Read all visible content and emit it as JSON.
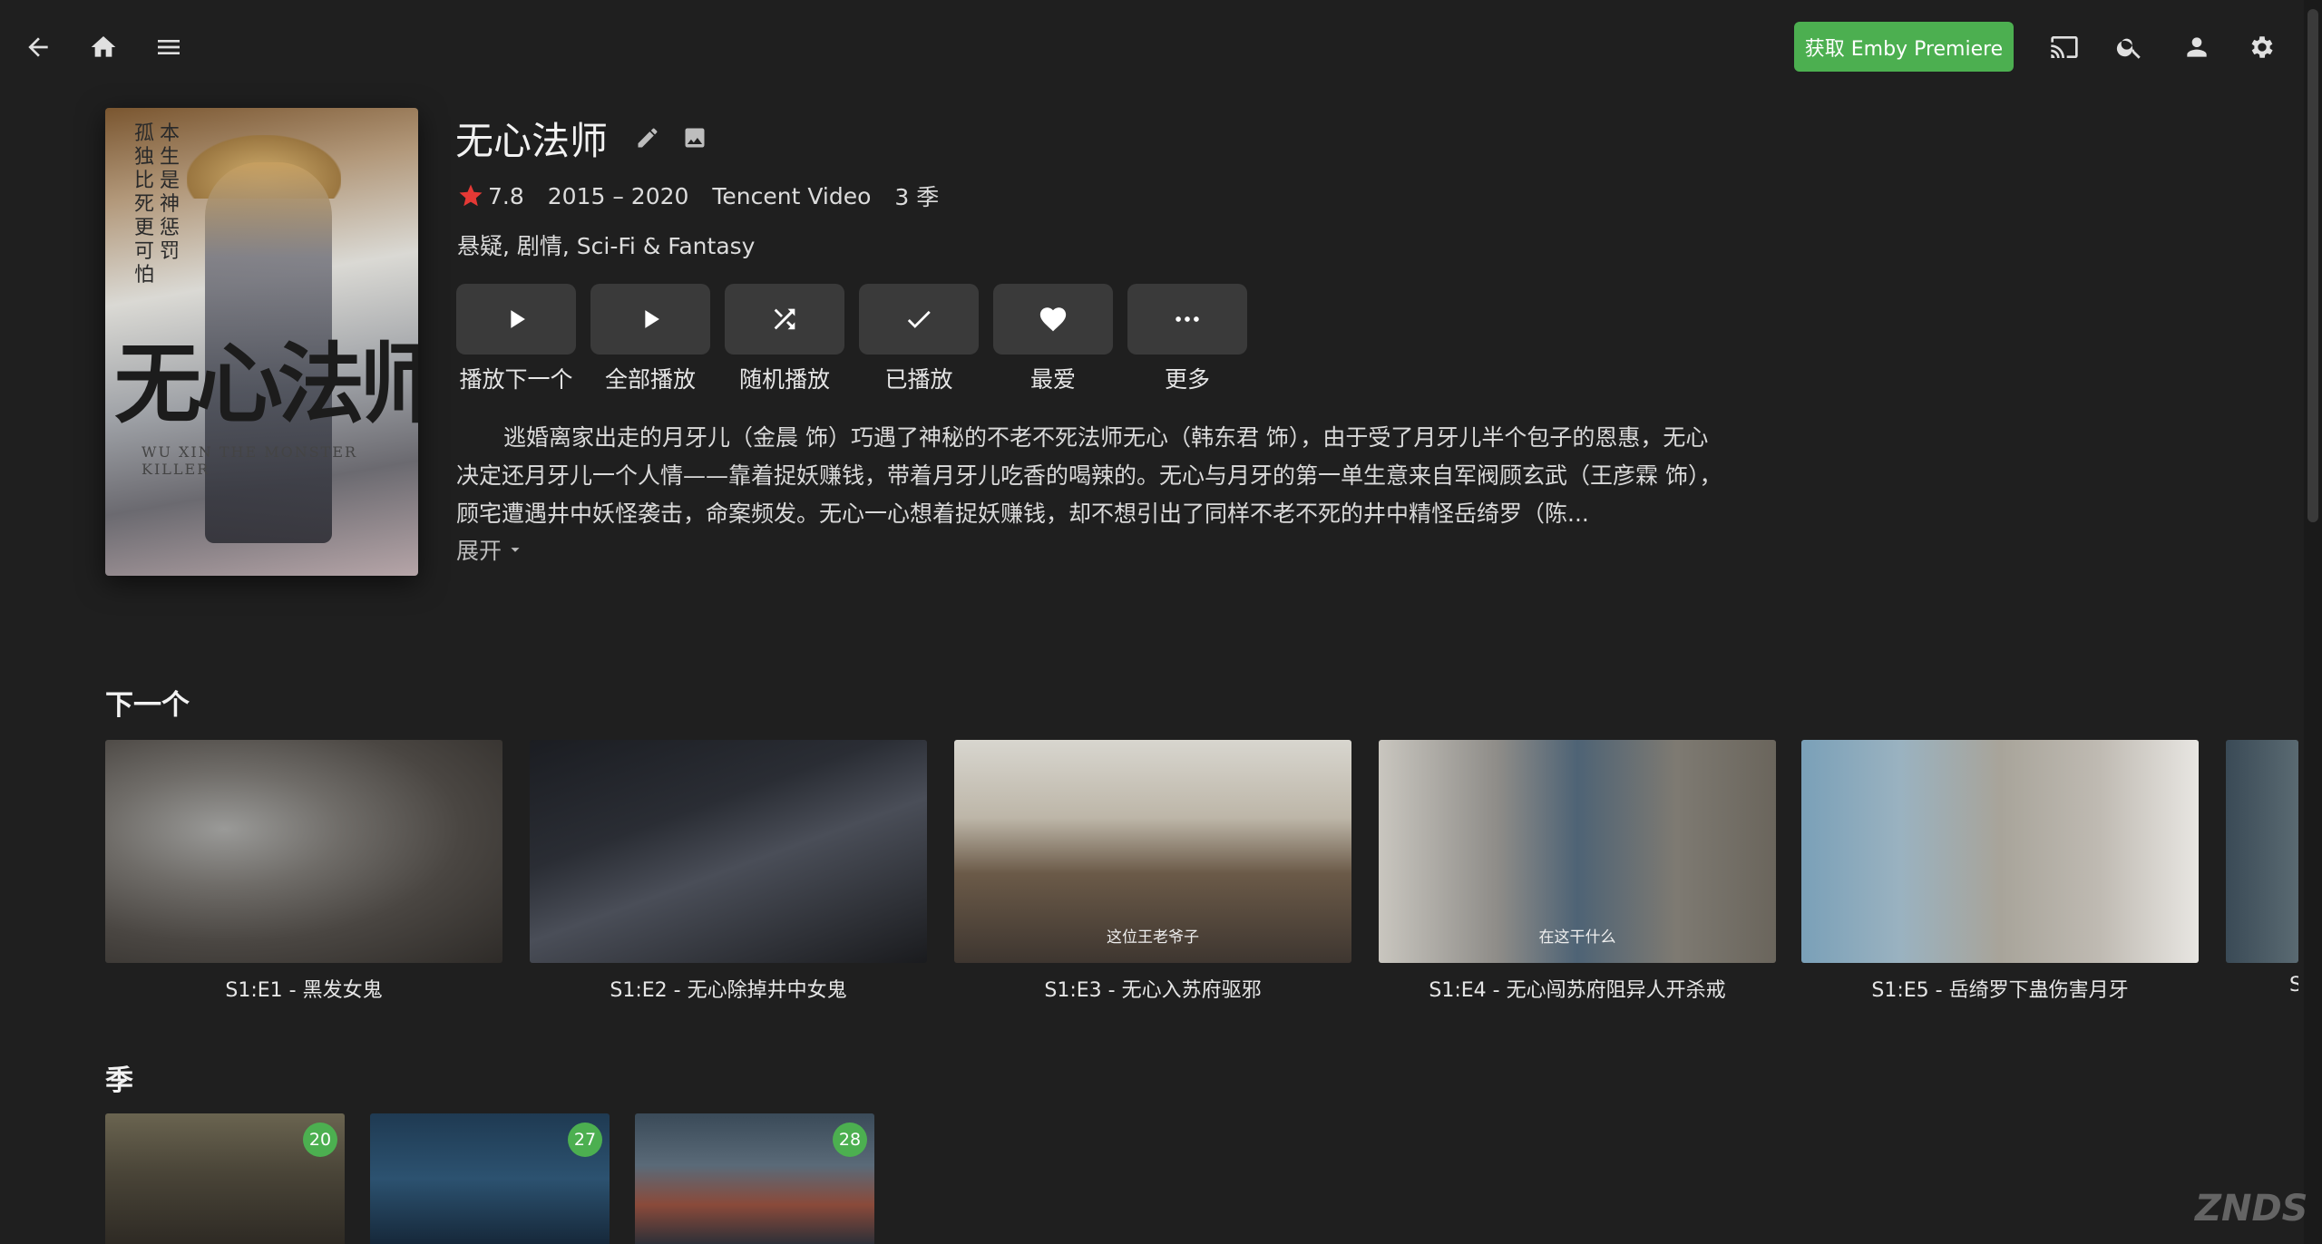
{
  "header": {
    "premiere_label": "获取 Emby Premiere",
    "icons": [
      "back-arrow-icon",
      "home-icon",
      "menu-icon",
      "cast-icon",
      "search-icon",
      "user-icon",
      "settings-gear-icon"
    ]
  },
  "series": {
    "title": "无心法师",
    "rating": "7.8",
    "years": "2015 – 2020",
    "network": "Tencent Video",
    "seasons_count": "3 季",
    "genres": "悬疑, 剧情, Sci-Fi & Fantasy",
    "overview": "逃婚离家出走的月牙儿（金晨 饰）巧遇了神秘的不老不死法师无心（韩东君 饰），由于受了月牙儿半个包子的恩惠，无心决定还月牙儿一个人情——靠着捉妖赚钱，带着月牙儿吃香的喝辣的。无心与月牙的第一单生意来自军阀顾玄武（王彦霖 饰），顾宅遭遇井中妖怪袭击，命案频发。无心一心想着捉妖赚钱，却不想引出了同样不老不死的井中精怪岳绮罗（陈...",
    "expand_label": "展开",
    "poster": {
      "title_art": "无心法师",
      "english": "WU XIN THE MONSTER KILLER",
      "tagline_1": "本生是神惩罚",
      "tagline_2": "孤独比死更可怕"
    }
  },
  "actions": [
    {
      "label": "播放下一个",
      "icon": "play-icon"
    },
    {
      "label": "全部播放",
      "icon": "play-all-icon"
    },
    {
      "label": "随机播放",
      "icon": "shuffle-icon"
    },
    {
      "label": "已播放",
      "icon": "checkmark-icon"
    },
    {
      "label": "最爱",
      "icon": "heart-icon"
    },
    {
      "label": "更多",
      "icon": "more-dots-icon"
    }
  ],
  "next_up": {
    "title": "下一个",
    "episodes": [
      {
        "label": "S1:E1 - 黑发女鬼",
        "subtitle": ""
      },
      {
        "label": "S1:E2 - 无心除掉井中女鬼",
        "subtitle": ""
      },
      {
        "label": "S1:E3 - 无心入苏府驱邪",
        "subtitle": "这位王老爷子"
      },
      {
        "label": "S1:E4 - 无心闯苏府阻异人开杀戒",
        "subtitle": "在这干什么"
      },
      {
        "label": "S1:E5 - 岳绮罗下蛊伤害月牙",
        "subtitle": ""
      },
      {
        "label": "S",
        "subtitle": ""
      }
    ]
  },
  "seasons": {
    "title": "季",
    "items": [
      {
        "count": "20"
      },
      {
        "count": "27"
      },
      {
        "count": "28"
      }
    ]
  },
  "watermark": "ZNDS"
}
